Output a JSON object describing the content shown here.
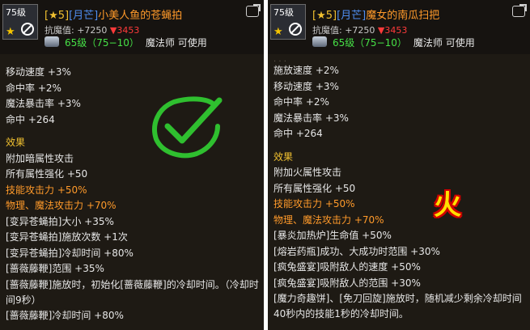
{
  "left": {
    "level_badge": "75级",
    "title_grade": "[★5]",
    "title_set": "[月芒]",
    "title_name": "小美人鱼的苍蝇拍",
    "resist_label": "抗魔值: +7250",
    "resist_down": "▼3453",
    "req_level": "65级（75−10）",
    "req_class": "魔法师 可使用",
    "stats": [
      "移动速度 +3%",
      "命中率 +2%",
      "魔法暴击率 +3%",
      "命中 +264"
    ],
    "effects_title": "效果",
    "effects": [
      {
        "text": "附加暗属性攻击",
        "color": "white"
      },
      {
        "text": "所有属性强化 +50",
        "color": "white"
      },
      {
        "text": "技能攻击力 +50%",
        "color": "orange"
      },
      {
        "text": "物理、魔法攻击力 +70%",
        "color": "orange"
      },
      {
        "text": "[变异苍蝇拍]大小 +35%",
        "color": "white"
      },
      {
        "text": "[变异苍蝇拍]施放次数 +1次",
        "color": "white"
      },
      {
        "text": "[变异苍蝇拍]冷却时间 +80%",
        "color": "white"
      },
      {
        "text": "[蔷薇藤鞭]范围 +35%",
        "color": "white"
      },
      {
        "text": "[蔷薇藤鞭]施放时，初始化[蔷薇藤鞭]的冷却时间。（冷却时间9秒）",
        "color": "white",
        "wrapped": true
      },
      {
        "text": "[蔷薇藤鞭]冷却时间 +80%",
        "color": "white"
      }
    ],
    "mark_icon": "check-mark-icon"
  },
  "right": {
    "level_badge": "75级",
    "title_grade": "[★5]",
    "title_set": "[月芒]",
    "title_name": "魔女的南瓜扫把",
    "resist_label": "抗魔值: +7250",
    "resist_down": "▼3453",
    "req_level": "65级（75−10）",
    "req_class": "魔法师 可使用",
    "stats": [
      "施放速度 +2%",
      "移动速度 +3%",
      "命中率 +2%",
      "魔法暴击率 +3%",
      "命中 +264"
    ],
    "effects_title": "效果",
    "effects": [
      {
        "text": "附加火属性攻击",
        "color": "white"
      },
      {
        "text": "所有属性强化 +50",
        "color": "white"
      },
      {
        "text": "技能攻击力 +50%",
        "color": "orange"
      },
      {
        "text": "物理、魔法攻击力 +70%",
        "color": "orange"
      },
      {
        "text": "[暴炎加热炉]生命值 +50%",
        "color": "white"
      },
      {
        "text": "[熔岩药瓶]成功、大成功时范围 +30%",
        "color": "white"
      },
      {
        "text": "[疯兔盛宴]吸附敌人的速度 +50%",
        "color": "white"
      },
      {
        "text": "[疯兔盛宴]吸附敌人的范围 +30%",
        "color": "white"
      },
      {
        "text": "[魔力奇趣饼]、[免刀回旋]施放时，随机减少剩余冷却时间40秒内的技能1秒的冷却时间。",
        "color": "white",
        "wrapped": true
      }
    ],
    "mark_text": "火",
    "mark_icon": "fire-character-icon"
  },
  "colors": {
    "orange": "#ff9a2a",
    "green": "#46e046",
    "blue": "#4f8ef0",
    "gold": "#f0c030",
    "red": "#ff3a3a",
    "check": "#2fbf2f"
  }
}
